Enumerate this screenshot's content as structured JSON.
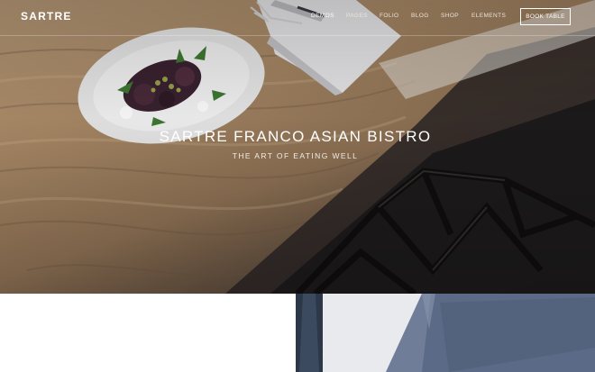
{
  "brand": {
    "logo_text": "SARTRE"
  },
  "nav": {
    "items": [
      {
        "label": "DEMOS",
        "active": true
      },
      {
        "label": "PAGES",
        "active": false
      },
      {
        "label": "FOLIO",
        "active": false
      },
      {
        "label": "BLOG",
        "active": false
      },
      {
        "label": "SHOP",
        "active": false
      },
      {
        "label": "ELEMENTS",
        "active": false
      }
    ],
    "cta_label": "BOOK TABLE"
  },
  "hero": {
    "title": "SARTRE FRANCO ASIAN BISTRO",
    "subtitle": "THE ART OF EATING WELL"
  },
  "colors": {
    "text_on_image": "#ffffff",
    "wood": "#a98966",
    "dark_chair": "#1f1c1c",
    "apron_blue": "#5b6a86"
  }
}
